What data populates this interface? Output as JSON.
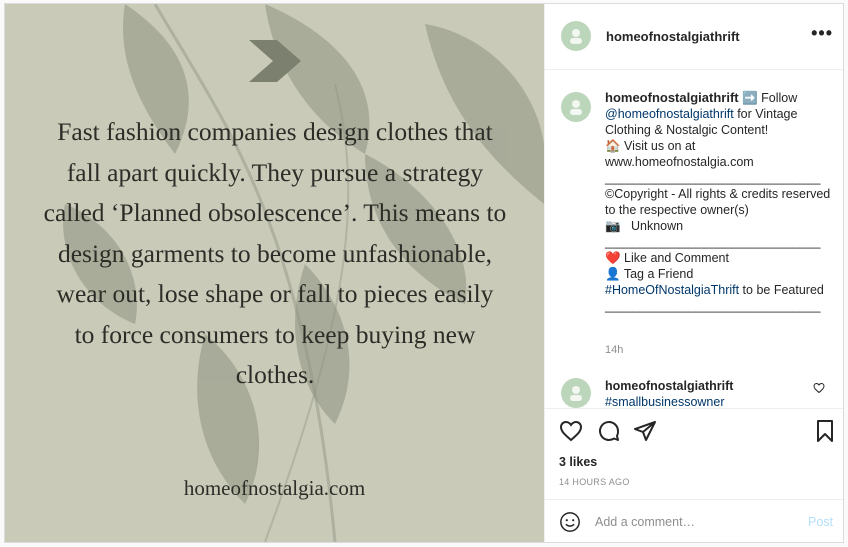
{
  "post": {
    "quote_lines": [
      "Fast fashion companies design clothes that",
      "fall apart quickly. They pursue a strategy",
      "called ‘Planned obsolescence’. This means to",
      "design garments to become unfashionable,",
      "wear out, lose shape or fall to pieces easily",
      "to force consumers to keep buying new",
      "clothes."
    ],
    "website": "homeofnostalgia.com"
  },
  "header": {
    "username": "homeofnostalgiathrift",
    "more": "•••"
  },
  "caption": {
    "username": "homeofnostalgiathrift",
    "arrow_emoji": "➡️",
    "follow_text": " Follow ",
    "mention": "@homeofnostalgiathrift",
    "line1_rest": " for Vintage Clothing & Nostalgic Content!",
    "house_emoji": "🏠",
    "visit_text": " Visit us on at www.homeofnostalgia.com",
    "divider": "_______________________________",
    "copyright": "©Copyright - All rights & credits reserved to the respective owner(s)",
    "camera_emoji": "📷",
    "unknown": "   Unknown",
    "heart_emoji": "❤️",
    "like_comment": " Like and Comment",
    "person_emoji": "👤",
    "tag_friend": " Tag a Friend",
    "hashtag": "#HomeOfNostalgiaThrift",
    "featured": " to be Featured",
    "time": "14h"
  },
  "comment": {
    "username": "homeofnostalgiathrift",
    "hashtag": "#smallbusinessowner"
  },
  "stats": {
    "likes": "3 likes",
    "ago": "14 HOURS AGO"
  },
  "comment_box": {
    "placeholder": "Add a comment…",
    "post_label": "Post"
  },
  "colors": {
    "image_bg": "#c9cab8",
    "text_dark": "#2d2d28",
    "avatar": "#bcd6bb",
    "link": "#00376b",
    "post_button": "#b2dffc"
  }
}
